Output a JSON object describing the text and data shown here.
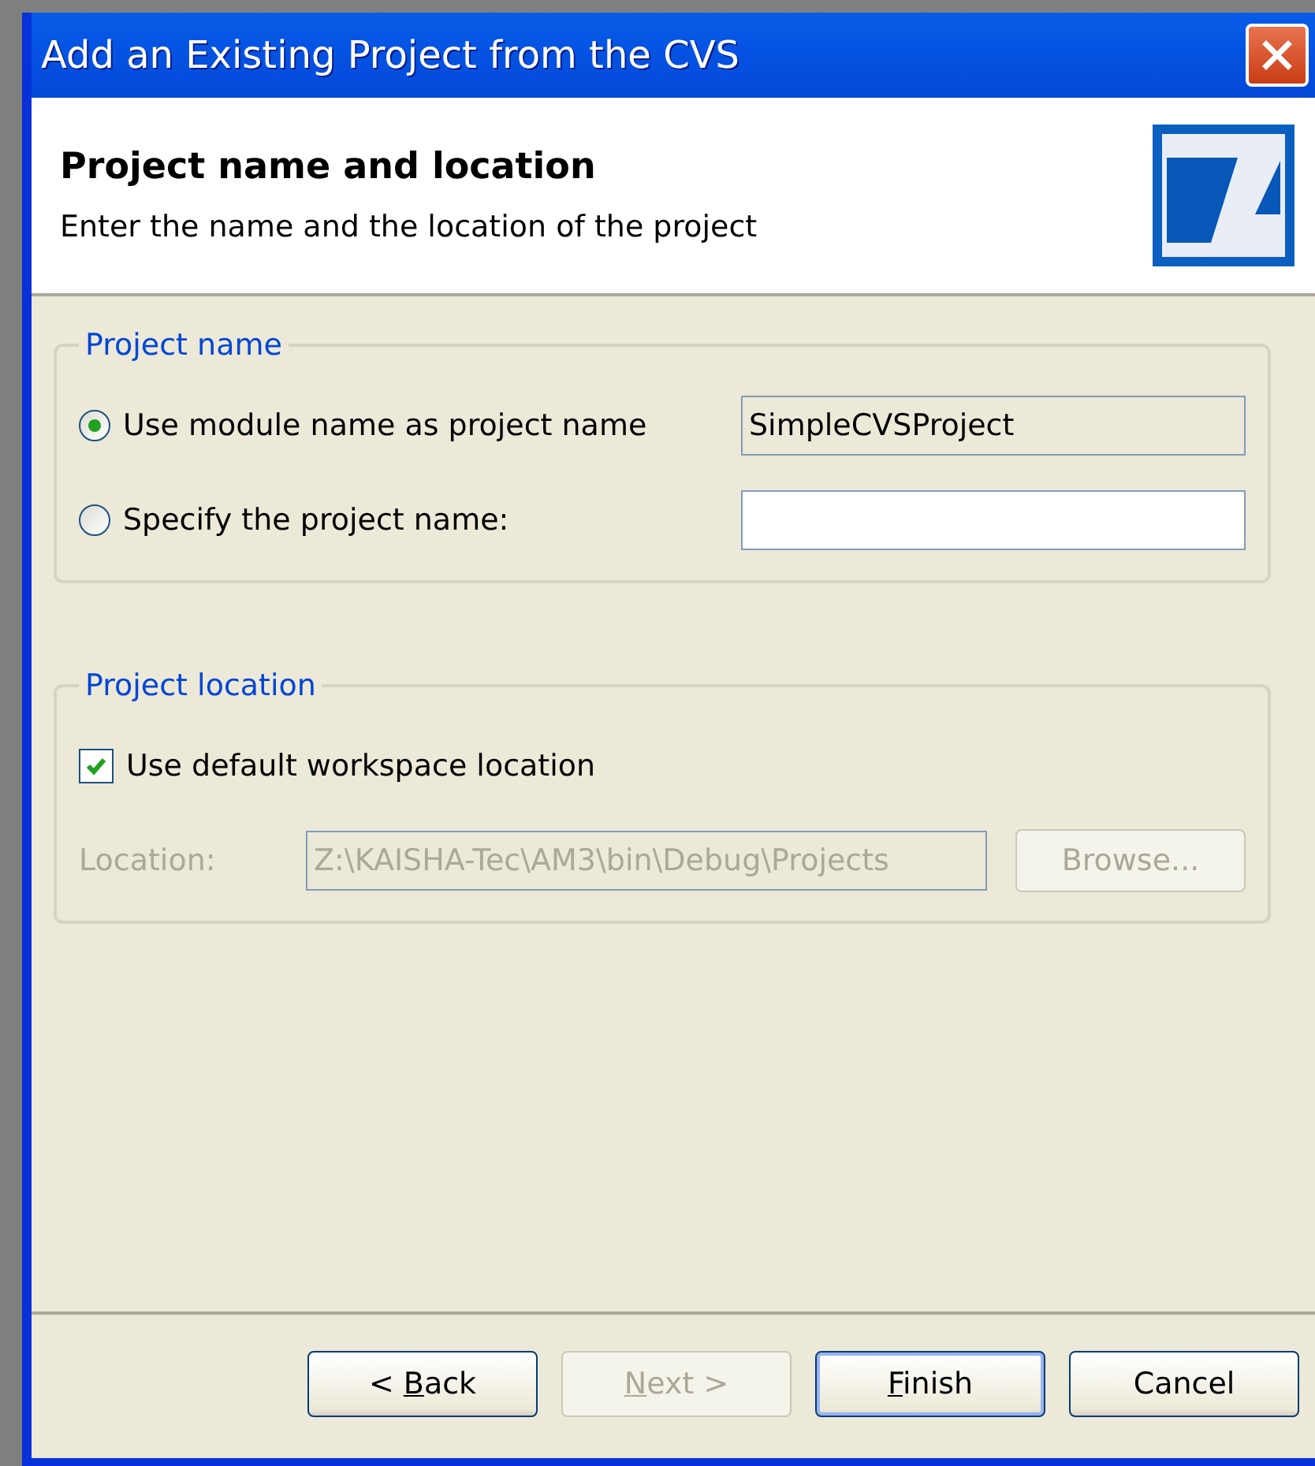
{
  "window": {
    "title": "Add an Existing Project from the CVS"
  },
  "header": {
    "title": "Project name and location",
    "subtitle": "Enter the name and the location of the project"
  },
  "project_name_group": {
    "legend": "Project name",
    "options": [
      {
        "label": "Use module name as project name",
        "selected": true,
        "field": {
          "value": "SimpleCVSProject",
          "readonly": true
        }
      },
      {
        "label": "Specify the project name:",
        "selected": false,
        "field": {
          "readonly": false
        }
      }
    ]
  },
  "project_location_group": {
    "legend": "Project location",
    "checkbox": {
      "label": "Use default workspace location",
      "checked": true
    },
    "location": {
      "label": "Location:",
      "value": "Z:\\KAISHA-Tec\\AM3\\bin\\Debug\\Projects",
      "disabled": true
    },
    "browse_button": {
      "label": "Browse...",
      "disabled": true
    }
  },
  "buttons": [
    {
      "before": "< ",
      "access_key": "B",
      "after": "ack",
      "disabled": false,
      "default": false
    },
    {
      "access_key": "N",
      "after": "ext >",
      "disabled": true,
      "default": false
    },
    {
      "access_key": "F",
      "after": "inish",
      "disabled": false,
      "default": true
    },
    {
      "before": "Cancel",
      "disabled": false,
      "default": false
    }
  ]
}
